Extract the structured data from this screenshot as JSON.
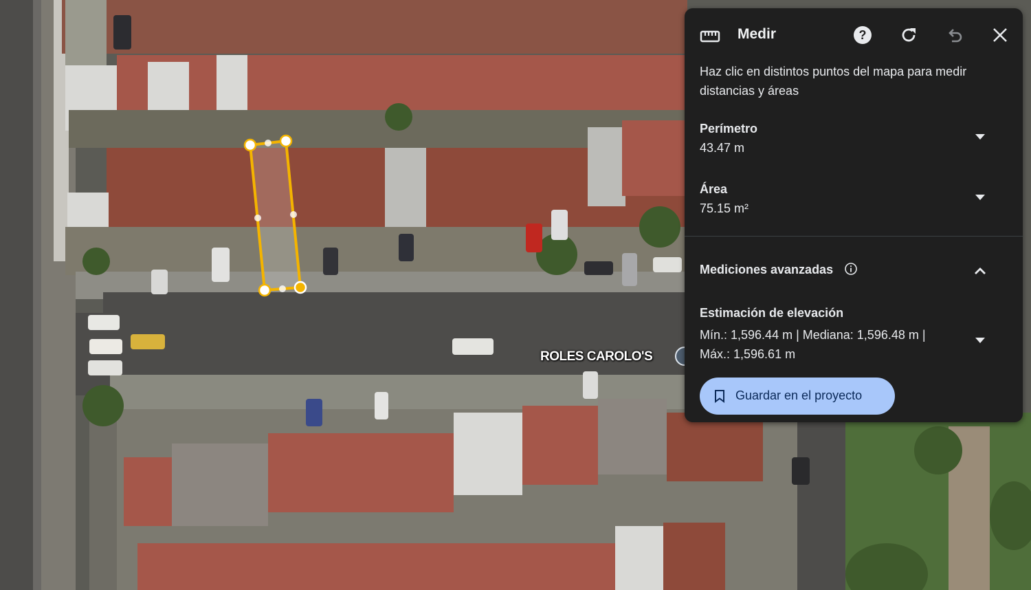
{
  "map": {
    "place_label": "ROLES CAROLO'S",
    "measure_color": "#f4b400"
  },
  "panel": {
    "title": "Medir",
    "icons": [
      "ruler-icon",
      "help-icon",
      "refresh-icon",
      "undo-icon",
      "close-icon"
    ],
    "instructions": "Haz clic en distintos puntos del mapa para medir distancias y áreas",
    "perimeter": {
      "label": "Perímetro",
      "value": "43.47 m"
    },
    "area": {
      "label": "Área",
      "value": "75.15 m²"
    },
    "advanced": {
      "label": "Mediciones avanzadas"
    },
    "elevation": {
      "label": "Estimación de elevación",
      "value": "Mín.: 1,596.44 m | Mediana: 1,596.48 m | Máx.: 1,596.61 m"
    },
    "save_label": "Guardar en el proyecto",
    "colors": {
      "panel_bg": "#1f1f1f",
      "button_bg": "#a8c7fa",
      "button_text": "#0b2a59"
    }
  }
}
